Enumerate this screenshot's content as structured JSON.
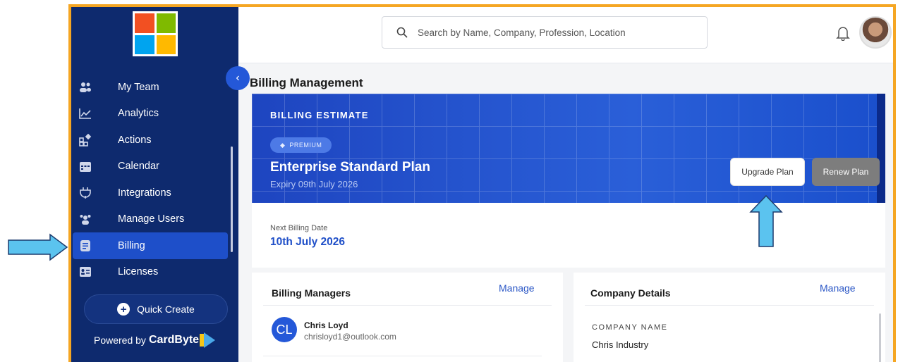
{
  "brand_colors": {
    "red": "#f25022",
    "green": "#7fba00",
    "blue": "#00a4ef",
    "yellow": "#ffb900"
  },
  "sidebar": {
    "items": [
      {
        "label": "My Team",
        "icon": "team-icon"
      },
      {
        "label": "Analytics",
        "icon": "chart-line-icon"
      },
      {
        "label": "Actions",
        "icon": "actions-icon"
      },
      {
        "label": "Calendar",
        "icon": "calendar-icon"
      },
      {
        "label": "Integrations",
        "icon": "plug-icon"
      },
      {
        "label": "Manage Users",
        "icon": "users-icon"
      },
      {
        "label": "Billing",
        "icon": "billing-icon",
        "active": true
      },
      {
        "label": "Licenses",
        "icon": "license-icon"
      }
    ],
    "quick_create": "Quick Create",
    "powered_prefix": "Powered by",
    "powered_brand": "CardByte"
  },
  "header": {
    "search_placeholder": "Search by Name, Company, Profession, Location"
  },
  "page": {
    "title": "Billing Management",
    "banner": {
      "section": "BILLING ESTIMATE",
      "badge": "PREMIUM",
      "plan": "Enterprise Standard Plan",
      "expiry": "Expiry 09th July 2026",
      "upgrade_label": "Upgrade Plan",
      "renew_label": "Renew Plan"
    },
    "next_billing": {
      "label": "Next Billing Date",
      "value": "10th July 2026"
    },
    "billing_managers": {
      "title": "Billing Managers",
      "manage": "Manage",
      "managers": [
        {
          "initials": "CL",
          "name": "Chris Loyd",
          "email": "chrisloyd1@outlook.com"
        }
      ]
    },
    "company_details": {
      "title": "Company Details",
      "manage": "Manage",
      "company_name_label": "COMPANY NAME",
      "company_name": "Chris Industry"
    }
  }
}
